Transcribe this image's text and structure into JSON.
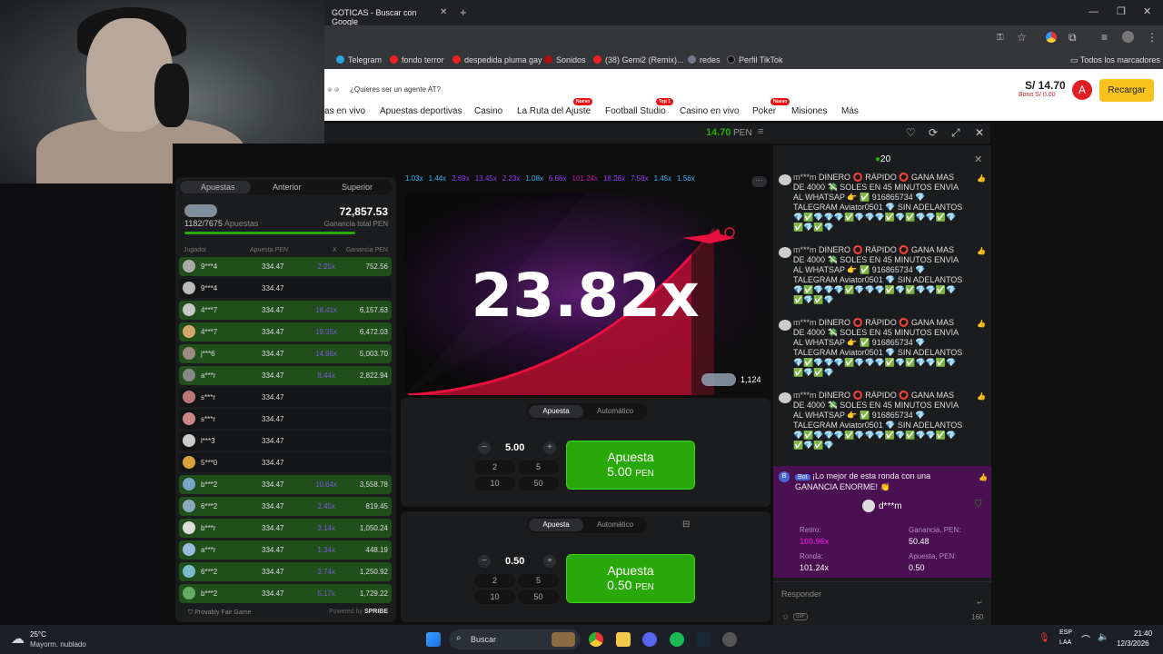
{
  "browser": {
    "tab_title": "GOTICAS - Buscar con Google",
    "bookmarks": [
      "Telegram",
      "fondo terror",
      "despedida pluma gay",
      "Sonidos",
      "(38) Gemi2 (Remix)...",
      "redes",
      "Perfil TikTok"
    ],
    "all_bookmarks": "Todos los marcadores"
  },
  "site": {
    "agent_prompt": "¿Quieres ser un agente AT?",
    "balance": "S/ 14.70",
    "bonus": "Bono S/ 0.00",
    "avatar_letter": "A",
    "recharge": "Recargar",
    "nav": [
      "as en vivo",
      "Apuestas deportivas",
      "Casino",
      "La Ruta del Ajuste",
      "Football Studio",
      "Casino en vivo",
      "Poker",
      "Misiones",
      "Más"
    ],
    "badge_nuevo": "Nuevo",
    "badge_top": "Top 1"
  },
  "game": {
    "balance": "14.70",
    "currency": "PEN",
    "online": "20",
    "tabs": [
      "Apuestas",
      "Anterior",
      "Superior"
    ],
    "total_win": "72,857.53",
    "bets_count": "1182/7675",
    "bets_label": "Apuestas",
    "total_label": "Ganancia total PEN",
    "cols": [
      "Jugador",
      "Apuesta PEN",
      "X",
      "Ganancia PEN"
    ],
    "rows": [
      {
        "player": "9***4",
        "bet": "334.47",
        "mult": "2.25x",
        "win": "752.56",
        "won": true
      },
      {
        "player": "9***4",
        "bet": "334.47",
        "mult": "",
        "win": "",
        "won": false
      },
      {
        "player": "4***7",
        "bet": "334.47",
        "mult": "18.41x",
        "win": "6,157.63",
        "won": true
      },
      {
        "player": "4***7",
        "bet": "334.47",
        "mult": "19.35x",
        "win": "6,472.03",
        "won": true
      },
      {
        "player": "j***6",
        "bet": "334.47",
        "mult": "14.96x",
        "win": "5,003.70",
        "won": true
      },
      {
        "player": "a***r",
        "bet": "334.47",
        "mult": "8.44x",
        "win": "2,822.94",
        "won": true
      },
      {
        "player": "s***r",
        "bet": "334.47",
        "mult": "",
        "win": "",
        "won": false
      },
      {
        "player": "s***r",
        "bet": "334.47",
        "mult": "",
        "win": "",
        "won": false
      },
      {
        "player": "l***3",
        "bet": "334.47",
        "mult": "",
        "win": "",
        "won": false
      },
      {
        "player": "5***0",
        "bet": "334.47",
        "mult": "",
        "win": "",
        "won": false
      },
      {
        "player": "b***2",
        "bet": "334.47",
        "mult": "10.64x",
        "win": "3,558.78",
        "won": true
      },
      {
        "player": "6***2",
        "bet": "334.47",
        "mult": "2.45x",
        "win": "819.45",
        "won": true
      },
      {
        "player": "b***r",
        "bet": "334.47",
        "mult": "3.14x",
        "win": "1,050.24",
        "won": true
      },
      {
        "player": "a***r",
        "bet": "334.47",
        "mult": "1.34x",
        "win": "448.19",
        "won": true
      },
      {
        "player": "6***2",
        "bet": "334.47",
        "mult": "3.74x",
        "win": "1,250.92",
        "won": true
      },
      {
        "player": "b***2",
        "bet": "334.47",
        "mult": "5.17x",
        "win": "1,729.22",
        "won": true
      }
    ],
    "provably_fair": "Provably Fair Game",
    "powered": "Powered by",
    "spribe": "SPRIBE",
    "history": [
      "1.03x",
      "1.44x",
      "2.69x",
      "13.45x",
      "2.23x",
      "1.08x",
      "6.66x",
      "101.24x",
      "18.26x",
      "7.58x",
      "1.45x",
      "1.56x"
    ],
    "history_colors": [
      "#34b4ff",
      "#34b4ff",
      "#913ef8",
      "#913ef8",
      "#913ef8",
      "#34b4ff",
      "#913ef8",
      "#c017b4",
      "#913ef8",
      "#913ef8",
      "#34b4ff",
      "#34b4ff"
    ],
    "multiplier": "23.82x",
    "players_in": "1,124",
    "panel_tabs": [
      "Apuesta",
      "Automático"
    ],
    "bet1": {
      "amount": "5.00",
      "quick": [
        "2",
        "5",
        "10",
        "50"
      ],
      "btn": "Apuesta",
      "btn_amount": "5.00",
      "btn_cur": "PEN"
    },
    "bet2": {
      "amount": "0.50",
      "quick": [
        "2",
        "5",
        "10",
        "50"
      ],
      "btn": "Apuesta",
      "btn_amount": "0.50",
      "btn_cur": "PEN"
    }
  },
  "chat": {
    "messages": [
      {
        "user": "m***m",
        "text": "DINERO ⭕ RÁPIDO ⭕ GANA MAS DE 4000 💸 SOLES EN 45 MINUTOS ENVIA AL WHATSAP 👉 ✅ 916865734 💎 TALEGRAM Aviator0501 💎 SIN ADELANTOS 💎✅💎💎💎✅💎💎💎✅💎✅💎💎✅💎✅💎✅💎"
      },
      {
        "user": "m***m",
        "text": "DINERO ⭕ RÁPIDO ⭕ GANA MAS DE 4000 💸 SOLES EN 45 MINUTOS ENVIA AL WHATSAP 👉 ✅ 916865734 💎 TALEGRAM Aviator0501 💎 SIN ADELANTOS 💎✅💎💎💎✅💎💎💎✅💎✅💎💎✅💎✅💎✅💎"
      },
      {
        "user": "m***m",
        "text": "DINERO ⭕ RÁPIDO ⭕ GANA MAS DE 4000 💸 SOLES EN 45 MINUTOS ENVIA AL WHATSAP 👉 ✅ 916865734 💎 TALEGRAM Aviator0501 💎 SIN ADELANTOS 💎✅💎💎💎✅💎💎💎✅💎✅💎💎✅💎✅💎✅💎"
      },
      {
        "user": "m***m",
        "text": "DINERO ⭕ RÁPIDO ⭕ GANA MAS DE 4000 💸 SOLES EN 45 MINUTOS ENVIA AL WHATSAP 👉 ✅ 916865734 💎 TALEGRAM Aviator0501 💎 SIN ADELANTOS 💎✅💎💎💎✅💎💎💎✅💎✅💎💎✅💎✅💎✅💎"
      }
    ],
    "bot_tag": "Bot",
    "bot_text": "¡Lo mejor de esta ronda con una GANANCIA ENORME! 👏",
    "winner": "d***m",
    "retiro_label": "Retiro:",
    "retiro": "100.96x",
    "gan_label": "Ganancia, PEN:",
    "gan": "50.48",
    "ronda_label": "Ronda:",
    "ronda": "101.24x",
    "apuesta_label": "Apuesta, PEN:",
    "apuesta": "0.50",
    "input_placeholder": "Responder",
    "gif": "GIF",
    "chars_left": "160"
  },
  "taskbar": {
    "temp": "25°C",
    "weather": "Mayorm. nublado",
    "search": "Buscar",
    "lang1": "ESP",
    "lang2": "LAA",
    "time": "21:40",
    "date": "12/3/2026"
  }
}
